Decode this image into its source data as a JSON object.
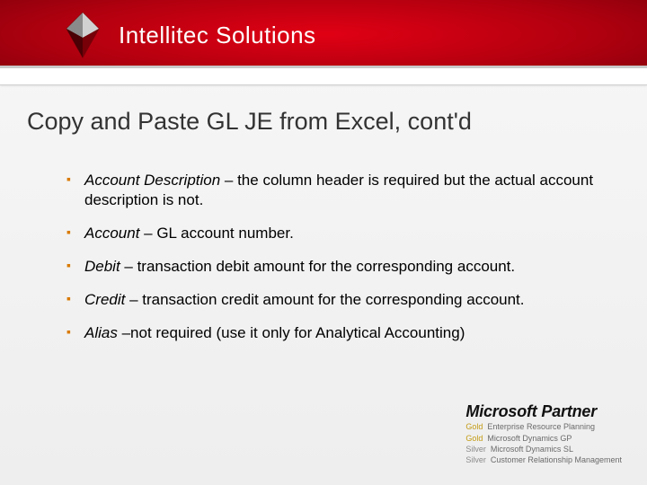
{
  "brand": {
    "name": "Intellitec Solutions"
  },
  "title": "Copy and Paste GL JE from Excel, cont'd",
  "bullets": [
    {
      "lead": "Account Description",
      "rest": " – the column header is required but the actual account description is not."
    },
    {
      "lead": "Account",
      "rest": " – GL account number."
    },
    {
      "lead": "Debit",
      "rest": " – transaction debit amount for the corresponding account."
    },
    {
      "lead": "Credit",
      "rest": " – transaction credit amount for the corresponding account."
    },
    {
      "lead": "Alias",
      "rest": " –not required (use it only for Analytical Accounting)"
    }
  ],
  "partner": {
    "title": "Microsoft Partner",
    "lines": [
      {
        "tier": "Gold",
        "product": "Enterprise Resource Planning"
      },
      {
        "tier": "Gold",
        "product": "Microsoft Dynamics GP"
      },
      {
        "tier": "Silver",
        "product": "Microsoft Dynamics SL"
      },
      {
        "tier": "Silver",
        "product": "Customer Relationship Management"
      }
    ]
  }
}
